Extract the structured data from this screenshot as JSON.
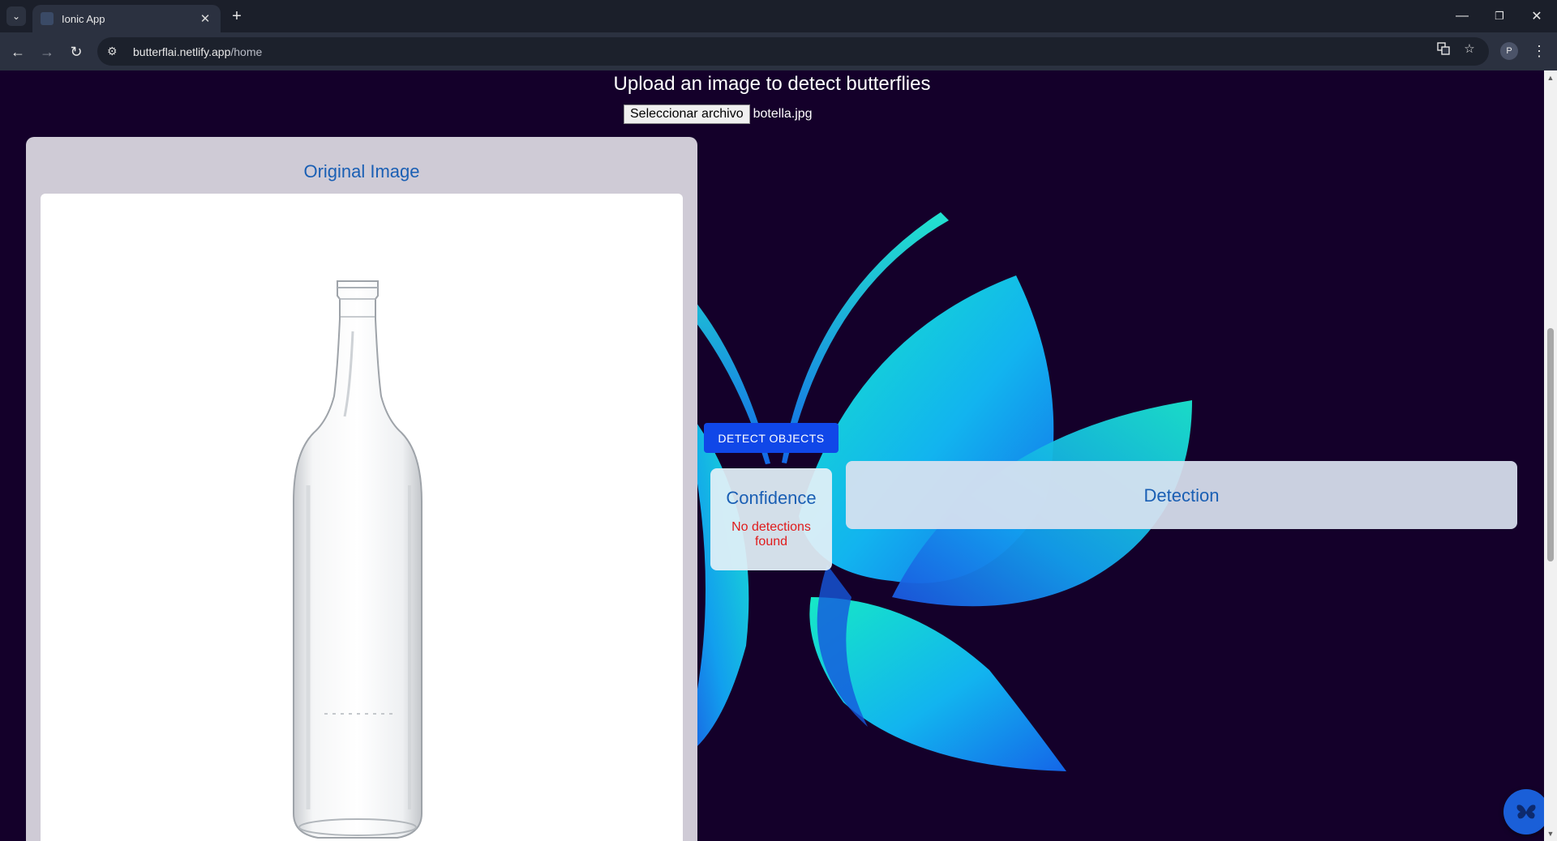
{
  "browser": {
    "tab_title": "Ionic App",
    "tab_close": "✕",
    "new_tab": "+",
    "url_host": "butterflai.netlify.app",
    "url_path": "/home",
    "profile_initial": "P",
    "window_minimize": "—",
    "window_restore": "❐",
    "window_close": "✕"
  },
  "page": {
    "heading": "Upload an image to detect butterflies",
    "file_button_label": "Seleccionar archivo",
    "file_name": "botella.jpg",
    "original_title": "Original Image",
    "detect_button_label": "DETECT OBJECTS",
    "confidence_title": "Confidence",
    "no_detections_text": "No detections found",
    "detection_title": "Detection"
  },
  "colors": {
    "page_background": "#14002a",
    "accent_blue": "#1a5fb4",
    "detect_button": "#1047e8",
    "error_red": "#e01b1b",
    "fab": "#1a5fd8"
  },
  "icons": {
    "uploaded_image": "glass-bottle",
    "background_logo": "butterfly-logo",
    "fab_icon": "butterfly-icon"
  }
}
